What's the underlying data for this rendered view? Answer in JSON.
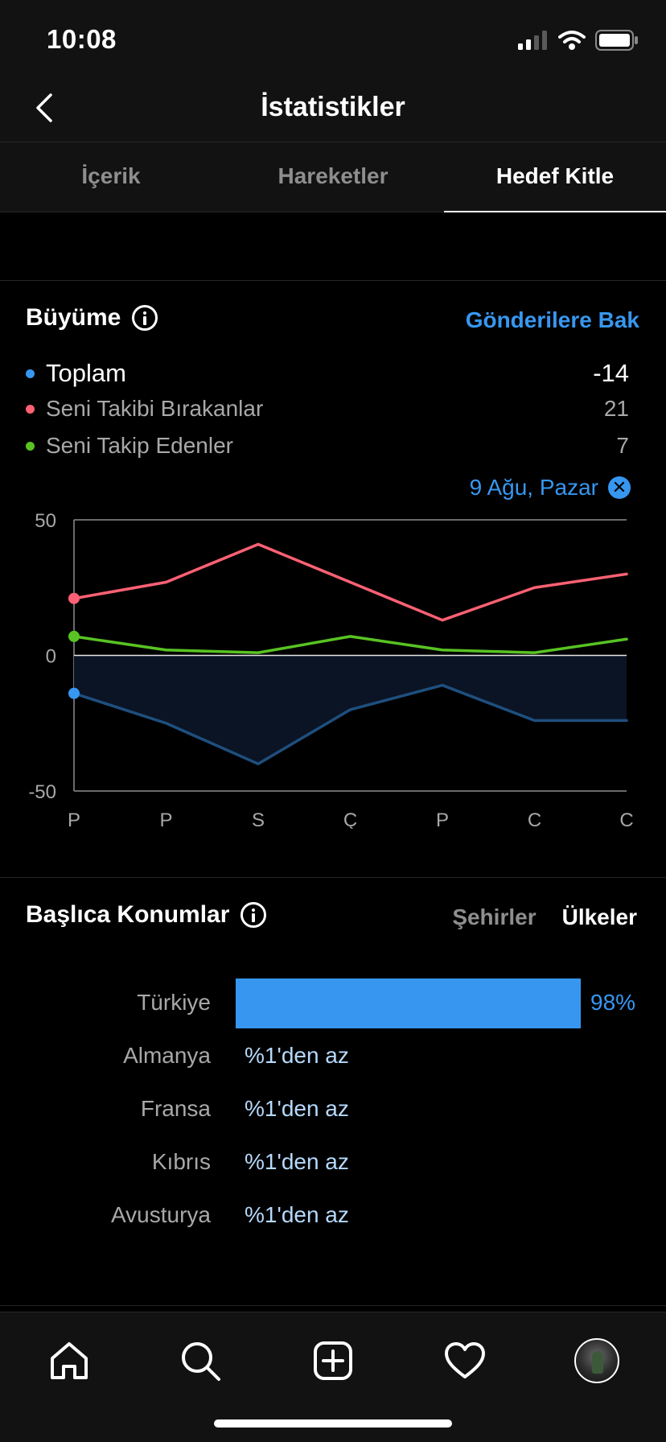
{
  "status": {
    "time": "10:08"
  },
  "header": {
    "title": "İstatistikler"
  },
  "tabs": [
    {
      "label": "İçerik",
      "active": false
    },
    {
      "label": "Hareketler",
      "active": false
    },
    {
      "label": "Hedef Kitle",
      "active": true
    }
  ],
  "growth": {
    "title": "Büyüme",
    "link": "Gönderilere Bak",
    "legend": [
      {
        "label": "Toplam",
        "value": "-14",
        "color": "#3797f0"
      },
      {
        "label": "Seni Takibi Bırakanlar",
        "value": "21",
        "color": "#ff6174"
      },
      {
        "label": "Seni Takip Edenler",
        "value": "7",
        "color": "#58c322"
      }
    ],
    "selected_date": "9 Ağu, Pazar",
    "close_glyph": "✕"
  },
  "chart_data": {
    "type": "line",
    "categories": [
      "P",
      "P",
      "S",
      "Ç",
      "P",
      "C",
      "C"
    ],
    "ylim": [
      -50,
      50
    ],
    "y_ticks": [
      "50",
      "0",
      "-50"
    ],
    "grid": false,
    "series": [
      {
        "name": "Seni Takibi Bırakanlar",
        "color": "#ff6174",
        "values": [
          21,
          27,
          41,
          27,
          13,
          25,
          30
        ]
      },
      {
        "name": "Seni Takip Edenler",
        "color": "#58c322",
        "values": [
          7,
          2,
          1,
          7,
          2,
          1,
          6
        ]
      },
      {
        "name": "Toplam",
        "color": "#1e4f7e",
        "values": [
          -14,
          -25,
          -40,
          -20,
          -11,
          -24,
          -24
        ]
      }
    ],
    "highlight_index": 0
  },
  "locations": {
    "title": "Başlıca Konumlar",
    "tabs": [
      {
        "label": "Şehirler",
        "active": false
      },
      {
        "label": "Ülkeler",
        "active": true
      }
    ],
    "rows": [
      {
        "name": "Türkiye",
        "value": "98%",
        "percent": 98
      },
      {
        "name": "Almanya",
        "value": "%1'den az",
        "percent": 0
      },
      {
        "name": "Fransa",
        "value": "%1'den az",
        "percent": 0
      },
      {
        "name": "Kıbrıs",
        "value": "%1'den az",
        "percent": 0
      },
      {
        "name": "Avusturya",
        "value": "%1'den az",
        "percent": 0
      }
    ]
  },
  "bottom_nav": [
    "home-icon",
    "search-icon",
    "new-post-icon",
    "heart-icon",
    "profile-avatar"
  ]
}
